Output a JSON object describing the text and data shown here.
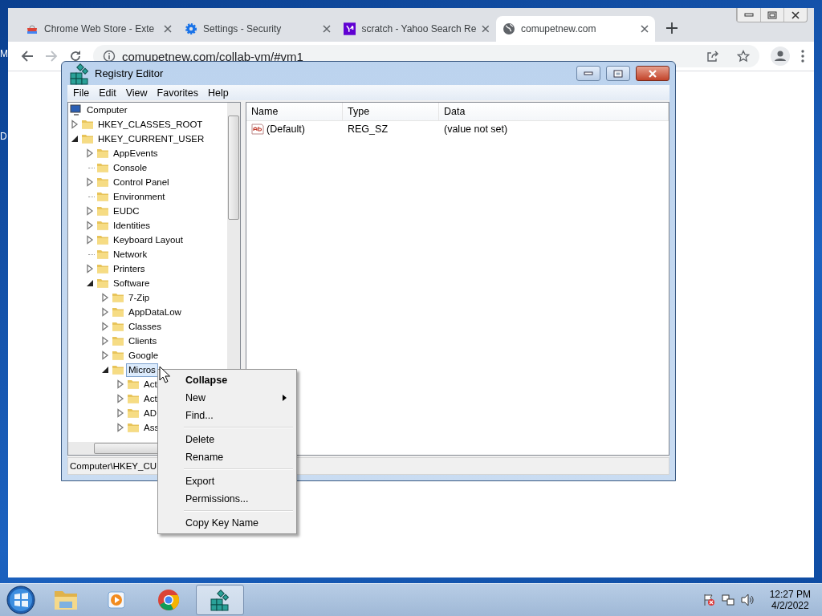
{
  "desktop": {
    "icon_labels": [
      "M",
      "D"
    ]
  },
  "browser": {
    "tabs": [
      {
        "kind": "store",
        "title": "Chrome Web Store - Exte",
        "selected": false
      },
      {
        "kind": "gear",
        "title": "Settings - Security",
        "selected": false
      },
      {
        "kind": "yahoo",
        "title": "scratch - Yahoo Search Re",
        "selected": false
      },
      {
        "kind": "globe",
        "title": "comupetnew.com",
        "selected": true
      }
    ],
    "address": "comupetnew.com/collab-vm/#vm1"
  },
  "registry_editor": {
    "title": "Registry Editor",
    "menu": [
      "File",
      "Edit",
      "View",
      "Favorites",
      "Help"
    ],
    "tree": {
      "label": "Computer",
      "children": [
        {
          "label": "HKEY_CLASSES_ROOT",
          "has_subkeys": true,
          "expanded": false,
          "selected": false
        },
        {
          "label": "HKEY_CURRENT_USER",
          "has_subkeys": true,
          "expanded": true,
          "selected": false,
          "children": [
            {
              "label": "AppEvents",
              "has_subkeys": true,
              "expanded": false,
              "selected": false
            },
            {
              "label": "Console",
              "has_subkeys": false,
              "selected": false
            },
            {
              "label": "Control Panel",
              "has_subkeys": true,
              "expanded": false,
              "selected": false
            },
            {
              "label": "Environment",
              "has_subkeys": false,
              "selected": false
            },
            {
              "label": "EUDC",
              "has_subkeys": true,
              "expanded": false,
              "selected": false
            },
            {
              "label": "Identities",
              "has_subkeys": true,
              "expanded": false,
              "selected": false
            },
            {
              "label": "Keyboard Layout",
              "has_subkeys": true,
              "expanded": false,
              "selected": false
            },
            {
              "label": "Network",
              "has_subkeys": false,
              "selected": false
            },
            {
              "label": "Printers",
              "has_subkeys": true,
              "expanded": false,
              "selected": false
            },
            {
              "label": "Software",
              "has_subkeys": true,
              "expanded": true,
              "selected": false,
              "children": [
                {
                  "label": "7-Zip",
                  "has_subkeys": true,
                  "expanded": false,
                  "selected": false
                },
                {
                  "label": "AppDataLow",
                  "has_subkeys": true,
                  "expanded": false,
                  "selected": false
                },
                {
                  "label": "Classes",
                  "has_subkeys": true,
                  "expanded": false,
                  "selected": false
                },
                {
                  "label": "Clients",
                  "has_subkeys": true,
                  "expanded": false,
                  "selected": false
                },
                {
                  "label": "Google",
                  "has_subkeys": true,
                  "expanded": false,
                  "selected": false
                },
                {
                  "label": "Micros",
                  "has_subkeys": true,
                  "expanded": true,
                  "selected": true,
                  "children": [
                    {
                      "label": "Act",
                      "has_subkeys": true,
                      "expanded": false,
                      "selected": false
                    },
                    {
                      "label": "Act",
                      "has_subkeys": true,
                      "expanded": false,
                      "selected": false
                    },
                    {
                      "label": "AD",
                      "has_subkeys": true,
                      "expanded": false,
                      "selected": false
                    },
                    {
                      "label": "Ass",
                      "has_subkeys": true,
                      "expanded": false,
                      "selected": false
                    }
                  ]
                }
              ]
            }
          ]
        }
      ]
    },
    "columns": [
      "Name",
      "Type",
      "Data"
    ],
    "values": [
      {
        "name": "(Default)",
        "type": "REG_SZ",
        "data": "(value not set)"
      }
    ],
    "status": "Computer\\HKEY_CU"
  },
  "context_menu": [
    {
      "kind": "item",
      "label": "Collapse",
      "default": true,
      "submenu": false
    },
    {
      "kind": "item",
      "label": "New",
      "default": false,
      "submenu": true
    },
    {
      "kind": "item",
      "label": "Find...",
      "default": false,
      "submenu": false
    },
    {
      "kind": "separator"
    },
    {
      "kind": "item",
      "label": "Delete",
      "default": false,
      "submenu": false
    },
    {
      "kind": "item",
      "label": "Rename",
      "default": false,
      "submenu": false
    },
    {
      "kind": "separator"
    },
    {
      "kind": "item",
      "label": "Export",
      "default": false,
      "submenu": false
    },
    {
      "kind": "item",
      "label": "Permissions...",
      "default": false,
      "submenu": false
    },
    {
      "kind": "separator"
    },
    {
      "kind": "item",
      "label": "Copy Key Name",
      "default": false,
      "submenu": false
    }
  ],
  "taskbar": {
    "buttons": [
      {
        "kind": "explorer",
        "selected": false
      },
      {
        "kind": "media",
        "selected": false
      },
      {
        "kind": "browser",
        "selected": false
      },
      {
        "kind": "registry",
        "selected": true
      }
    ],
    "time": "12:27 PM",
    "date": "4/2/2022"
  }
}
